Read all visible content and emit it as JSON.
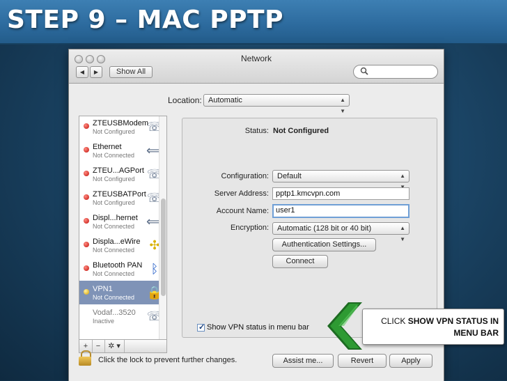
{
  "slide": {
    "title": "STEP 9 – MAC PPTP"
  },
  "window": {
    "title": "Network",
    "show_all": "Show All",
    "back_glyph": "◀",
    "forward_glyph": "▶",
    "search_placeholder": ""
  },
  "location": {
    "label": "Location:",
    "value": "Automatic"
  },
  "services": [
    {
      "name": "ZTEUSBModem",
      "status": "Not Configured",
      "dot": "red",
      "icon": "phone-icon",
      "selected": false
    },
    {
      "name": "Ethernet",
      "status": "Not Connected",
      "dot": "red",
      "icon": "ethernet-arrows-icon",
      "selected": false
    },
    {
      "name": "ZTEU...AGPort",
      "status": "Not Configured",
      "dot": "red",
      "icon": "phone-icon",
      "selected": false
    },
    {
      "name": "ZTEUSBATPort",
      "status": "Not Configured",
      "dot": "red",
      "icon": "phone-icon",
      "selected": false
    },
    {
      "name": "Displ...hernet",
      "status": "Not Connected",
      "dot": "red",
      "icon": "ethernet-arrows-icon",
      "selected": false
    },
    {
      "name": "Displa...eWire",
      "status": "Not Connected",
      "dot": "red",
      "icon": "firewire-icon",
      "selected": false
    },
    {
      "name": "Bluetooth PAN",
      "status": "Not Connected",
      "dot": "red",
      "icon": "bluetooth-icon",
      "selected": false
    },
    {
      "name": "VPN1",
      "status": "Not Connected",
      "dot": "yellow",
      "icon": "vpn-lock-icon",
      "selected": true
    },
    {
      "name": "Vodaf...3520",
      "status": "Inactive",
      "dot": "none",
      "icon": "phone-icon",
      "selected": false
    }
  ],
  "list_toolbar": {
    "add": "+",
    "remove": "−",
    "action": "✲ ▾"
  },
  "detail": {
    "status_label": "Status:",
    "status_value": "Not Configured",
    "configuration_label": "Configuration:",
    "configuration_value": "Default",
    "server_label": "Server Address:",
    "server_value": "pptp1.kmcvpn.com",
    "account_label": "Account Name:",
    "account_value": "user1",
    "encryption_label": "Encryption:",
    "encryption_value": "Automatic (128 bit or 40 bit)",
    "auth_button": "Authentication Settings...",
    "connect_button": "Connect",
    "show_vpn_status_label": "Show VPN status in menu bar",
    "show_vpn_status_checked": true
  },
  "footer": {
    "lock_text": "Click the lock to prevent further changes.",
    "assist": "Assist me...",
    "revert": "Revert",
    "apply": "Apply"
  },
  "callout": {
    "prefix": "CLICK ",
    "bold": "SHOW VPN STATUS IN MENU BAR"
  },
  "colors": {
    "arrow_green": "#2e9a33",
    "selected_row": "#7f93b7",
    "banner": "#2c6a9d"
  }
}
